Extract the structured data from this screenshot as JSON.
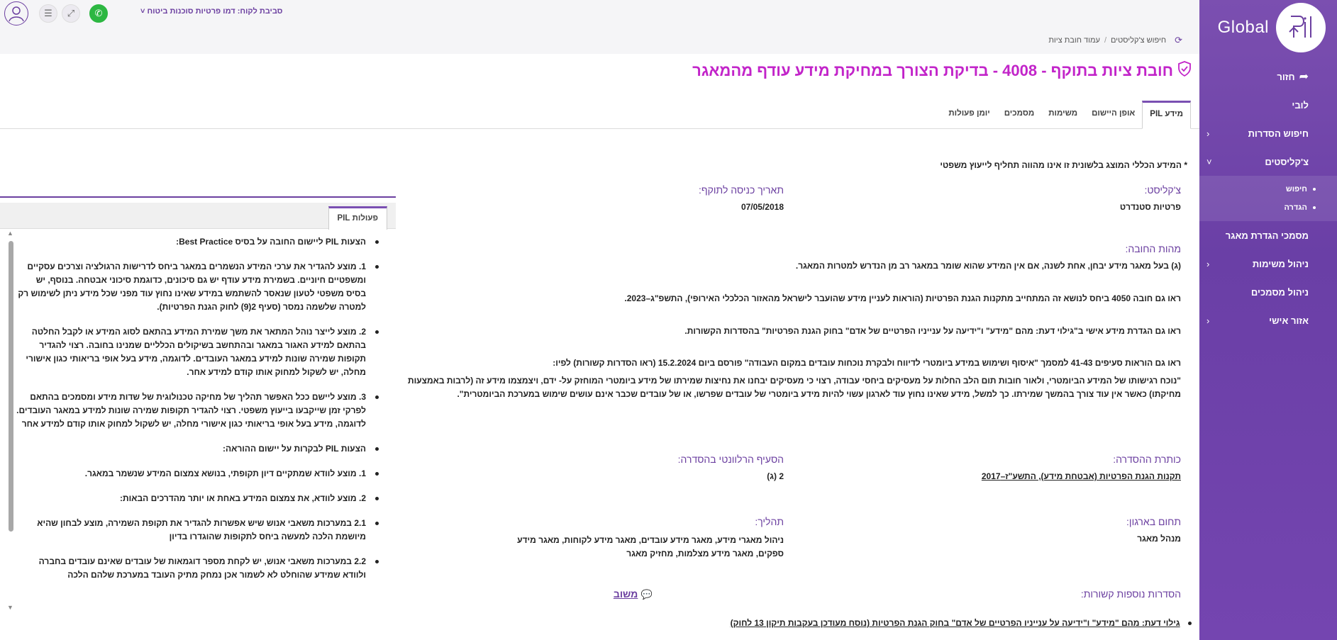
{
  "app": {
    "brand": "Global",
    "client_context": "סביבת לקוח: דמו פרטיות סוכנות ביטוח"
  },
  "sidebar": {
    "items": [
      {
        "label": "חזור",
        "icon": "back-arrow-icon"
      },
      {
        "label": "לובי"
      },
      {
        "label": "חיפוש הסדרות",
        "chevron": "‹"
      },
      {
        "label": "צ'קליסטים",
        "chevron": "˅"
      },
      {
        "label": "מסמכי הגדרת מאגר"
      },
      {
        "label": "ניהול משימות",
        "chevron": "‹"
      },
      {
        "label": "ניהול מסמכים"
      },
      {
        "label": "אזור אישי",
        "chevron": "‹"
      }
    ],
    "sub_items": [
      "חיפוש",
      "הגדרה"
    ]
  },
  "breadcrumb": {
    "items": [
      "חיפוש צ'קליסטים",
      "עמוד חובת ציות"
    ],
    "separator": "/"
  },
  "page": {
    "title": "חובת ציות בתוקף - 4008 - בדיקת הצורך במחיקת מידע עודף מהמאגר"
  },
  "tabs": [
    "מידע PIL",
    "אופן היישום",
    "משימות",
    "מסמכים",
    "יומן פעולות"
  ],
  "disclaimer": "* המידע הכללי המוצג בלשונית זו אינו מהווה תחליף לייעוץ משפטי",
  "details": {
    "checklist_label": "צ'קליסט:",
    "checklist_value": "פרטיות סטנדרט",
    "effective_label": "תאריך כניסה לתוקף:",
    "effective_value": "07/05/2018",
    "essence_label": "מהות החובה:",
    "essence_paras": [
      "(ג) בעל מאגר מידע יבחן, אחת לשנה, אם אין המידע שהוא שומר במאגר רב מן הנדרש למטרות המאגר.",
      "ראו גם חובה 4050 ביחס לנושא זה המתחייב מתקנות הגנת הפרטיות (הוראות לעניין מידע שהועבר לישראל מהאזור הכלכלי האירופי), התשפ\"ג–2023.",
      "ראו גם הגדרת מידע אישי ב\"גילוי דעת: מהם \"מידע\" ו\"ידיעה על ענייניו הפרטיים של אדם\" בחוק הגנת הפרטיות\" בהסדרות הקשורות.",
      "ראו גם הוראות סעיפים 41-43 למסמך \"איסוף ושימוש במידע ביומטרי לדיווח ולבקרת נוכחות עובדים במקום העבודה\" פורסם ביום 15.2.2024 (ראו הסדרות קשורות) לפיו:",
      "\"נוכח רגישותו של המידע הביומטרי, ולאור חובות תום הלב החלות על מעסיקים ביחסי עבודה, רצוי כי מעסיקים יבחנו את נחיצות שמירתו של מידע ביומטרי המוחזק על- ידם, ויצמצמו מידע זה (לרבות באמצעות מחיקתו) כאשר אין עוד צורך בהמשך שמירתו. כך למשל, מידע שאינו נחוץ עוד לארגון עשוי להיות מידע ביומטרי של עובדים שפרשו, או של עובדים שכבר אינם עושים שימוש במערכת הביומטרית\"."
    ],
    "reg_title_label": "כותרת ההסדרה:",
    "reg_title_value": "תקנות הגנת הפרטיות (אבטחת מידע), התשע\"ז–2017",
    "section_label": "הסעיף הרלוונטי בהסדרה:",
    "section_value": "2 (ג)",
    "org_area_label": "תחום בארגון:",
    "org_area_value": "מנהל מאגר",
    "process_label": "תהליך:",
    "process_value": "ניהול מאגרי מידע, מאגר מידע עובדים, מאגר מידע לקוחות, מאגר מידע ספקים, מאגר מידע מצלמות, מחזיק מאגר",
    "related_label": "הסדרות נוספות קשורות:",
    "chat_label": "משוב",
    "related_items": [
      "גילוי דעת: מהם \"מידע\" ו\"ידיעה על ענייניו הפרטיים של אדם\" בחוק הגנת הפרטיות (נוסח מעודכן בעקבות תיקון 13 לחוק)"
    ]
  },
  "pil_panel": {
    "tab_label": "פעולות PIL",
    "items": [
      "הצעות PIL ליישום החובה על בסיס Best Practice:",
      "1. מוצע להגדיר את ערכי המידע הנשמרים במאגר ביחס לדרישות הרגולציה וצרכים עסקיים ומשפטיים חיוניים. בשמירת מידע עודף יש גם סיכונים, כדוגמת סיכוני אבטחה. בנוסף, יש בסיס משפטי לטעון שנאסר להשתמש במידע שאינו נחוץ עוד מפני שכל מידע ניתן לשימוש רק למטרה שלשמה נמסר (סעיף 2(9) לחוק הגנת הפרטיות).",
      "2. מוצע לייצר נוהל המתאר את משך שמירת המידע בהתאם לסוג המידע או לקבל החלטה בהתאם למידע האגור במאגר ובהתחשב בשיקולים הכלליים שמנינו בחובה. רצוי להגדיר תקופות שמירה שונות למידע במאגר העובדים. לדוגמה, מידע בעל אופי בריאותי כגון אישורי מחלה, יש לשקול למחוק אותו קודם למידע אחר.",
      "3. מוצע ליישם ככל האפשר תהליך של מחיקה טכנולוגית של שדות מידע ומסמכים בהתאם לפרקי זמן שייקבעו בייעוץ משפטי. רצוי להגדיר תקופות שמירה שונות למידע במאגר העובדים. לדוגמה, מידע בעל אופי בריאותי כגון אישורי מחלה, יש לשקול למחוק אותו קודם למידע אחר",
      "הצעות PIL לבקרות על יישום ההוראה:",
      "1. מוצע לוודא שמתקיים דיון תקופתי, בנושא צמצום המידע שנשמר במאגר.",
      "2. מוצע לוודא, את צמצום המידע באחת או יותר מהדרכים הבאות:",
      "2.1 במערכות משאבי אנוש שיש אפשרות להגדיר את תקופת השמירה, מוצע לבחון שהיא מיושמת הלכה למעשה ביחס לתקופות שהוגדרו בדיון",
      "2.2 במערכות משאבי אנוש, יש לקחת מספר דוגמאות של עובדים שאינם עובדים בחברה ולוודא שמידע שהוחלט לא לשמור אכן נמחק מתיק העובד במערכת שלהם הלכה"
    ]
  },
  "colors": {
    "brand_purple": "#6b3fa0",
    "title_magenta": "#c224c9",
    "whatsapp_green": "#2db742"
  }
}
